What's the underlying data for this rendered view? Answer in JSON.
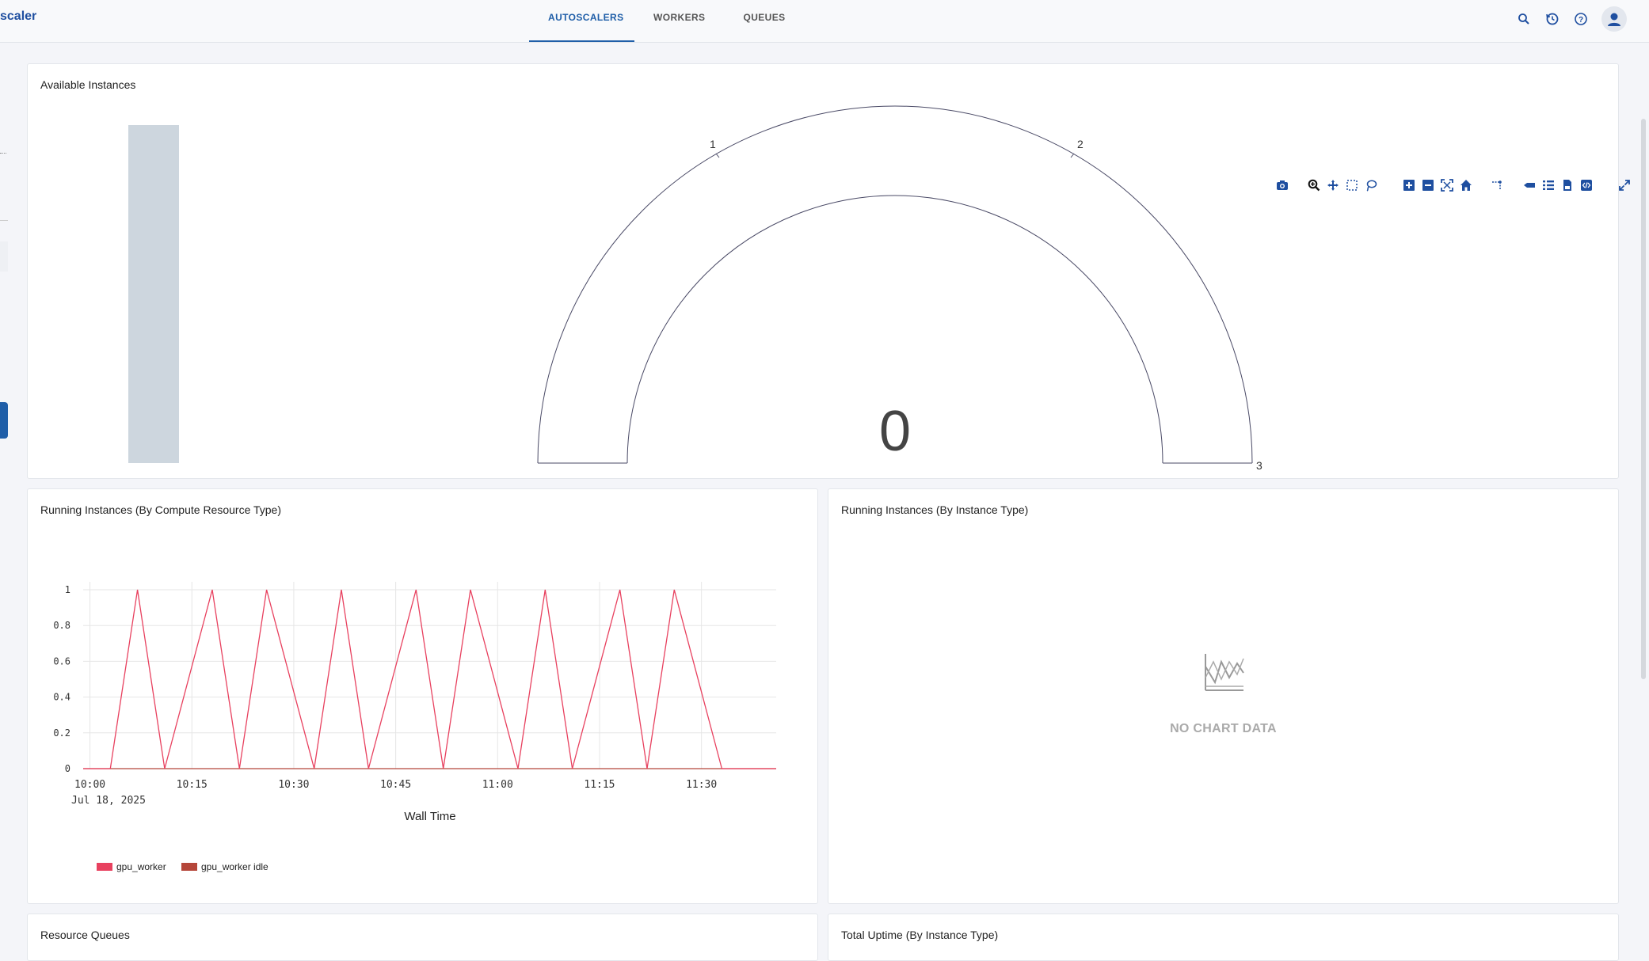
{
  "app": {
    "brand": "scaler"
  },
  "nav": {
    "tabs": [
      {
        "label": "AUTOSCALERS",
        "active": true
      },
      {
        "label": "WORKERS",
        "active": false
      },
      {
        "label": "QUEUES",
        "active": false
      }
    ]
  },
  "top_icons": [
    "search-icon",
    "history-icon",
    "help-icon",
    "user-avatar-icon"
  ],
  "colors": {
    "accent": "#1f5ea8",
    "series1": "#e8415f",
    "series2": "#b5463a",
    "gauge_bar": "#cdd6de"
  },
  "panels": {
    "available": {
      "title": "Available Instances",
      "gauge_value": "0",
      "gauge_ticks": [
        "1",
        "2",
        "3"
      ],
      "modebar": [
        "camera-icon",
        "zoom-icon",
        "pan-icon",
        "box-select-icon",
        "lasso-icon",
        "zoom-in-icon",
        "zoom-out-icon",
        "autoscale-icon",
        "home-icon",
        "spike-lines-icon",
        "hover-closest-icon",
        "hover-compare-icon",
        "csv-download-icon",
        "code-icon",
        "fullscreen-icon"
      ]
    },
    "running_compute": {
      "title": "Running Instances (By Compute Resource Type)"
    },
    "running_instance": {
      "title": "Running Instances (By Instance Type)",
      "empty_text": "NO CHART DATA"
    },
    "resource_queues": {
      "title": "Resource Queues"
    },
    "total_uptime": {
      "title": "Total Uptime (By Instance Type)"
    }
  },
  "chart_data": [
    {
      "type": "gauge",
      "title": "Available Instances",
      "value": 0,
      "range": [
        0,
        3
      ],
      "ticks": [
        1,
        2,
        3
      ]
    },
    {
      "type": "line",
      "title": "Running Instances (By Compute Resource Type)",
      "xlabel": "Wall Time",
      "x_tick_labels": [
        "10:00",
        "10:15",
        "10:30",
        "10:45",
        "11:00",
        "11:15",
        "11:30"
      ],
      "x_date_label": "Jul 18, 2025",
      "y_tick_labels": [
        "0",
        "0.2",
        "0.4",
        "0.6",
        "0.8",
        "1"
      ],
      "ylim": [
        0,
        1
      ],
      "series": [
        {
          "name": "gpu_worker",
          "x": [
            "09:59",
            "10:03",
            "10:07",
            "10:11",
            "10:18",
            "10:22",
            "10:26",
            "10:33",
            "10:37",
            "10:41",
            "10:48",
            "10:52",
            "10:56",
            "11:03",
            "11:07",
            "11:11",
            "11:18",
            "11:22",
            "11:26",
            "11:33",
            "11:41"
          ],
          "y": [
            0,
            0,
            1,
            0,
            1,
            0,
            1,
            0,
            1,
            0,
            1,
            0,
            1,
            0,
            1,
            0,
            1,
            0,
            1,
            0,
            0
          ]
        },
        {
          "name": "gpu_worker idle",
          "x": [
            "09:59",
            "11:41"
          ],
          "y": [
            0,
            0
          ]
        }
      ],
      "legend": "bottom-left"
    }
  ]
}
